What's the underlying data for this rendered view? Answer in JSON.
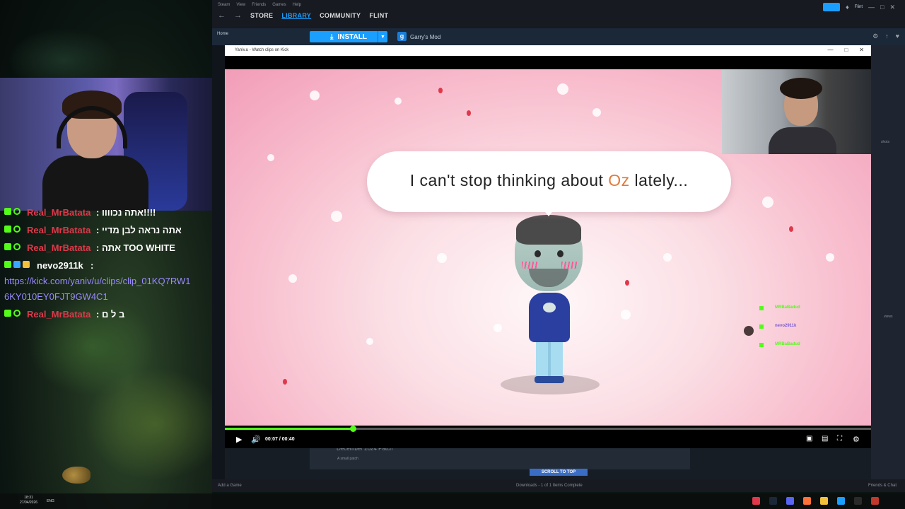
{
  "steam": {
    "menu": [
      "Steam",
      "View",
      "Friends",
      "Games",
      "Help"
    ],
    "tabs": [
      "STORE",
      "LIBRARY",
      "COMMUNITY",
      "FLINT"
    ],
    "account": "Flint",
    "home_label": "Home",
    "install_label": "INSTALL",
    "game_name": "Garry's Mod",
    "screenshots_label": "shots",
    "reviews_label": "views",
    "patch_title": "December 2024 Patch",
    "patch_sub": "A small patch",
    "scroll_top": "SCROLL TO TOP",
    "add_game": "Add a Game",
    "downloads": "Downloads - 1 of 1 Items Complete",
    "friends_chat": "Friends & Chat"
  },
  "player": {
    "window_title": "Yaniv.u - Watch clips on Kick",
    "bubble_before": "I can't stop thinking about ",
    "bubble_name": "Oz",
    "bubble_after": " lately...",
    "time": "00:07 / 00:40",
    "progress": 0.198,
    "mini_chat": [
      {
        "user": "MRBaBadud"
      },
      {
        "user": "nevo2911k"
      },
      {
        "user": "MRBaBadud"
      }
    ]
  },
  "chat": [
    {
      "user": "Real_MrBatata",
      "message": ": אתה נכוווו!!!!",
      "user_color": "#e0384a"
    },
    {
      "user": "Real_MrBatata",
      "message": ": אתה נראה לבן מדיי",
      "user_color": "#e0384a"
    },
    {
      "user": "Real_MrBatata",
      "message": ": אתה TOO WHITE",
      "user_color": "#e0384a"
    },
    {
      "user": "nevo2911k",
      "message": ":",
      "user_color": "#ffffff"
    },
    {
      "user": "Real_MrBatata",
      "message": ": ב ל ם",
      "user_color": "#e0384a"
    }
  ],
  "chat_link": {
    "line1": "https://kick.com/yaniv/u/clips/clip_01KQ7RW1",
    "line2": "6KY010EY0FJT9GW4C1"
  },
  "taskbar": {
    "time": "18:31",
    "date": "27/04/2026",
    "lang": "ENG"
  }
}
